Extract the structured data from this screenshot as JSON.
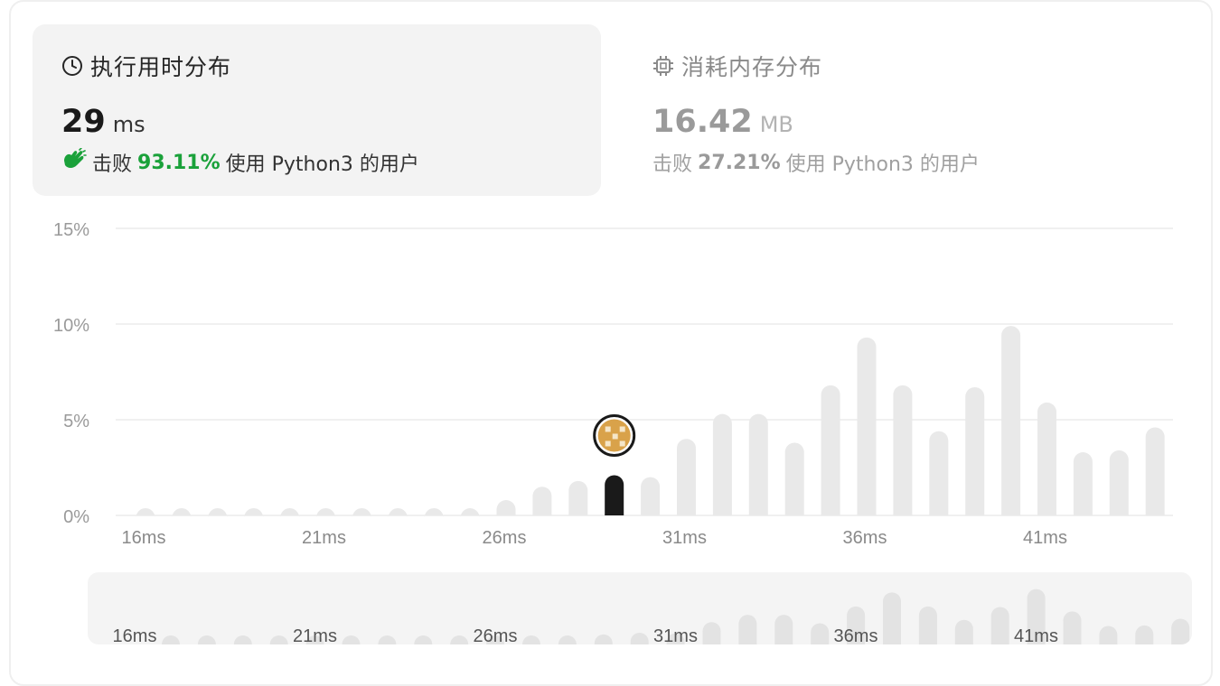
{
  "runtime": {
    "title": "执行用时分布",
    "value": "29",
    "unit": "ms",
    "beats_prefix": "击败",
    "beats_pct": "93.11%",
    "beats_suffix": "使用 Python3 的用户",
    "icon": "clock-icon",
    "accent_color": "#1aa13a"
  },
  "memory": {
    "title": "消耗内存分布",
    "value": "16.42",
    "unit": "MB",
    "beats_prefix": "击败",
    "beats_pct": "27.21%",
    "beats_suffix": "使用 Python3 的用户",
    "icon": "cpu-chip-icon"
  },
  "chart_data": {
    "type": "bar",
    "title": "",
    "xlabel": "",
    "ylabel": "",
    "ylim": [
      0,
      15
    ],
    "yticks": [
      "0%",
      "5%",
      "10%",
      "15%"
    ],
    "xtick_labels": [
      "16ms",
      "21ms",
      "26ms",
      "31ms",
      "36ms",
      "41ms"
    ],
    "categories": [
      16,
      17,
      18,
      19,
      20,
      21,
      22,
      23,
      24,
      25,
      26,
      27,
      28,
      29,
      30,
      31,
      32,
      33,
      34,
      35,
      36,
      37,
      38,
      39,
      40,
      41,
      42,
      43
    ],
    "values": [
      0.1,
      0.1,
      0.1,
      0.1,
      0.1,
      0.1,
      0.1,
      0.1,
      0.1,
      0.1,
      0.8,
      1.5,
      1.8,
      2.1,
      2.0,
      4.0,
      5.3,
      5.3,
      3.8,
      6.8,
      9.3,
      6.8,
      4.4,
      6.7,
      9.9,
      5.9,
      3.3,
      3.4,
      4.6
    ],
    "highlight_category": 29,
    "highlight_color": "#1a1a1a",
    "bar_color": "#e9e9e9",
    "grid": true
  }
}
